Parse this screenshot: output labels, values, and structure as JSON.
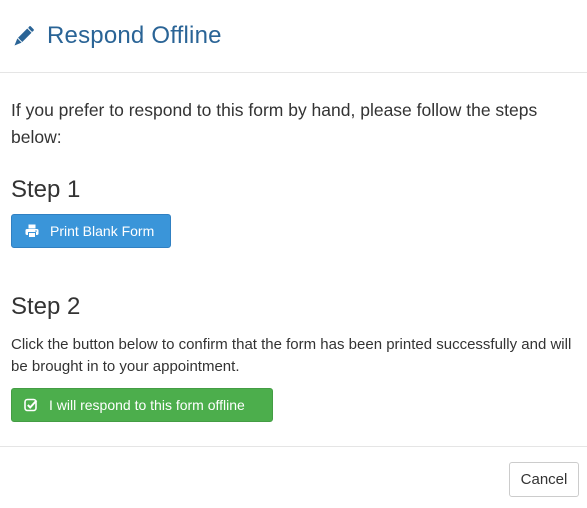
{
  "header": {
    "title": "Respond Offline",
    "icon": "pencil-icon",
    "title_color": "#2a6496"
  },
  "body": {
    "intro": "If you prefer to respond to this form by hand, please follow the steps below:",
    "step1": {
      "title": "Step 1",
      "button_label": "Print Blank Form",
      "button_icon": "printer-icon",
      "button_color": "#3a95d9"
    },
    "step2": {
      "title": "Step 2",
      "description": "Click the button below to confirm that the form has been printed successfully and will be brought in to your appointment.",
      "button_label": "I will respond to this form offline",
      "button_icon": "checkbox-checked-icon",
      "button_color": "#4cae4c"
    }
  },
  "footer": {
    "cancel_label": "Cancel"
  }
}
